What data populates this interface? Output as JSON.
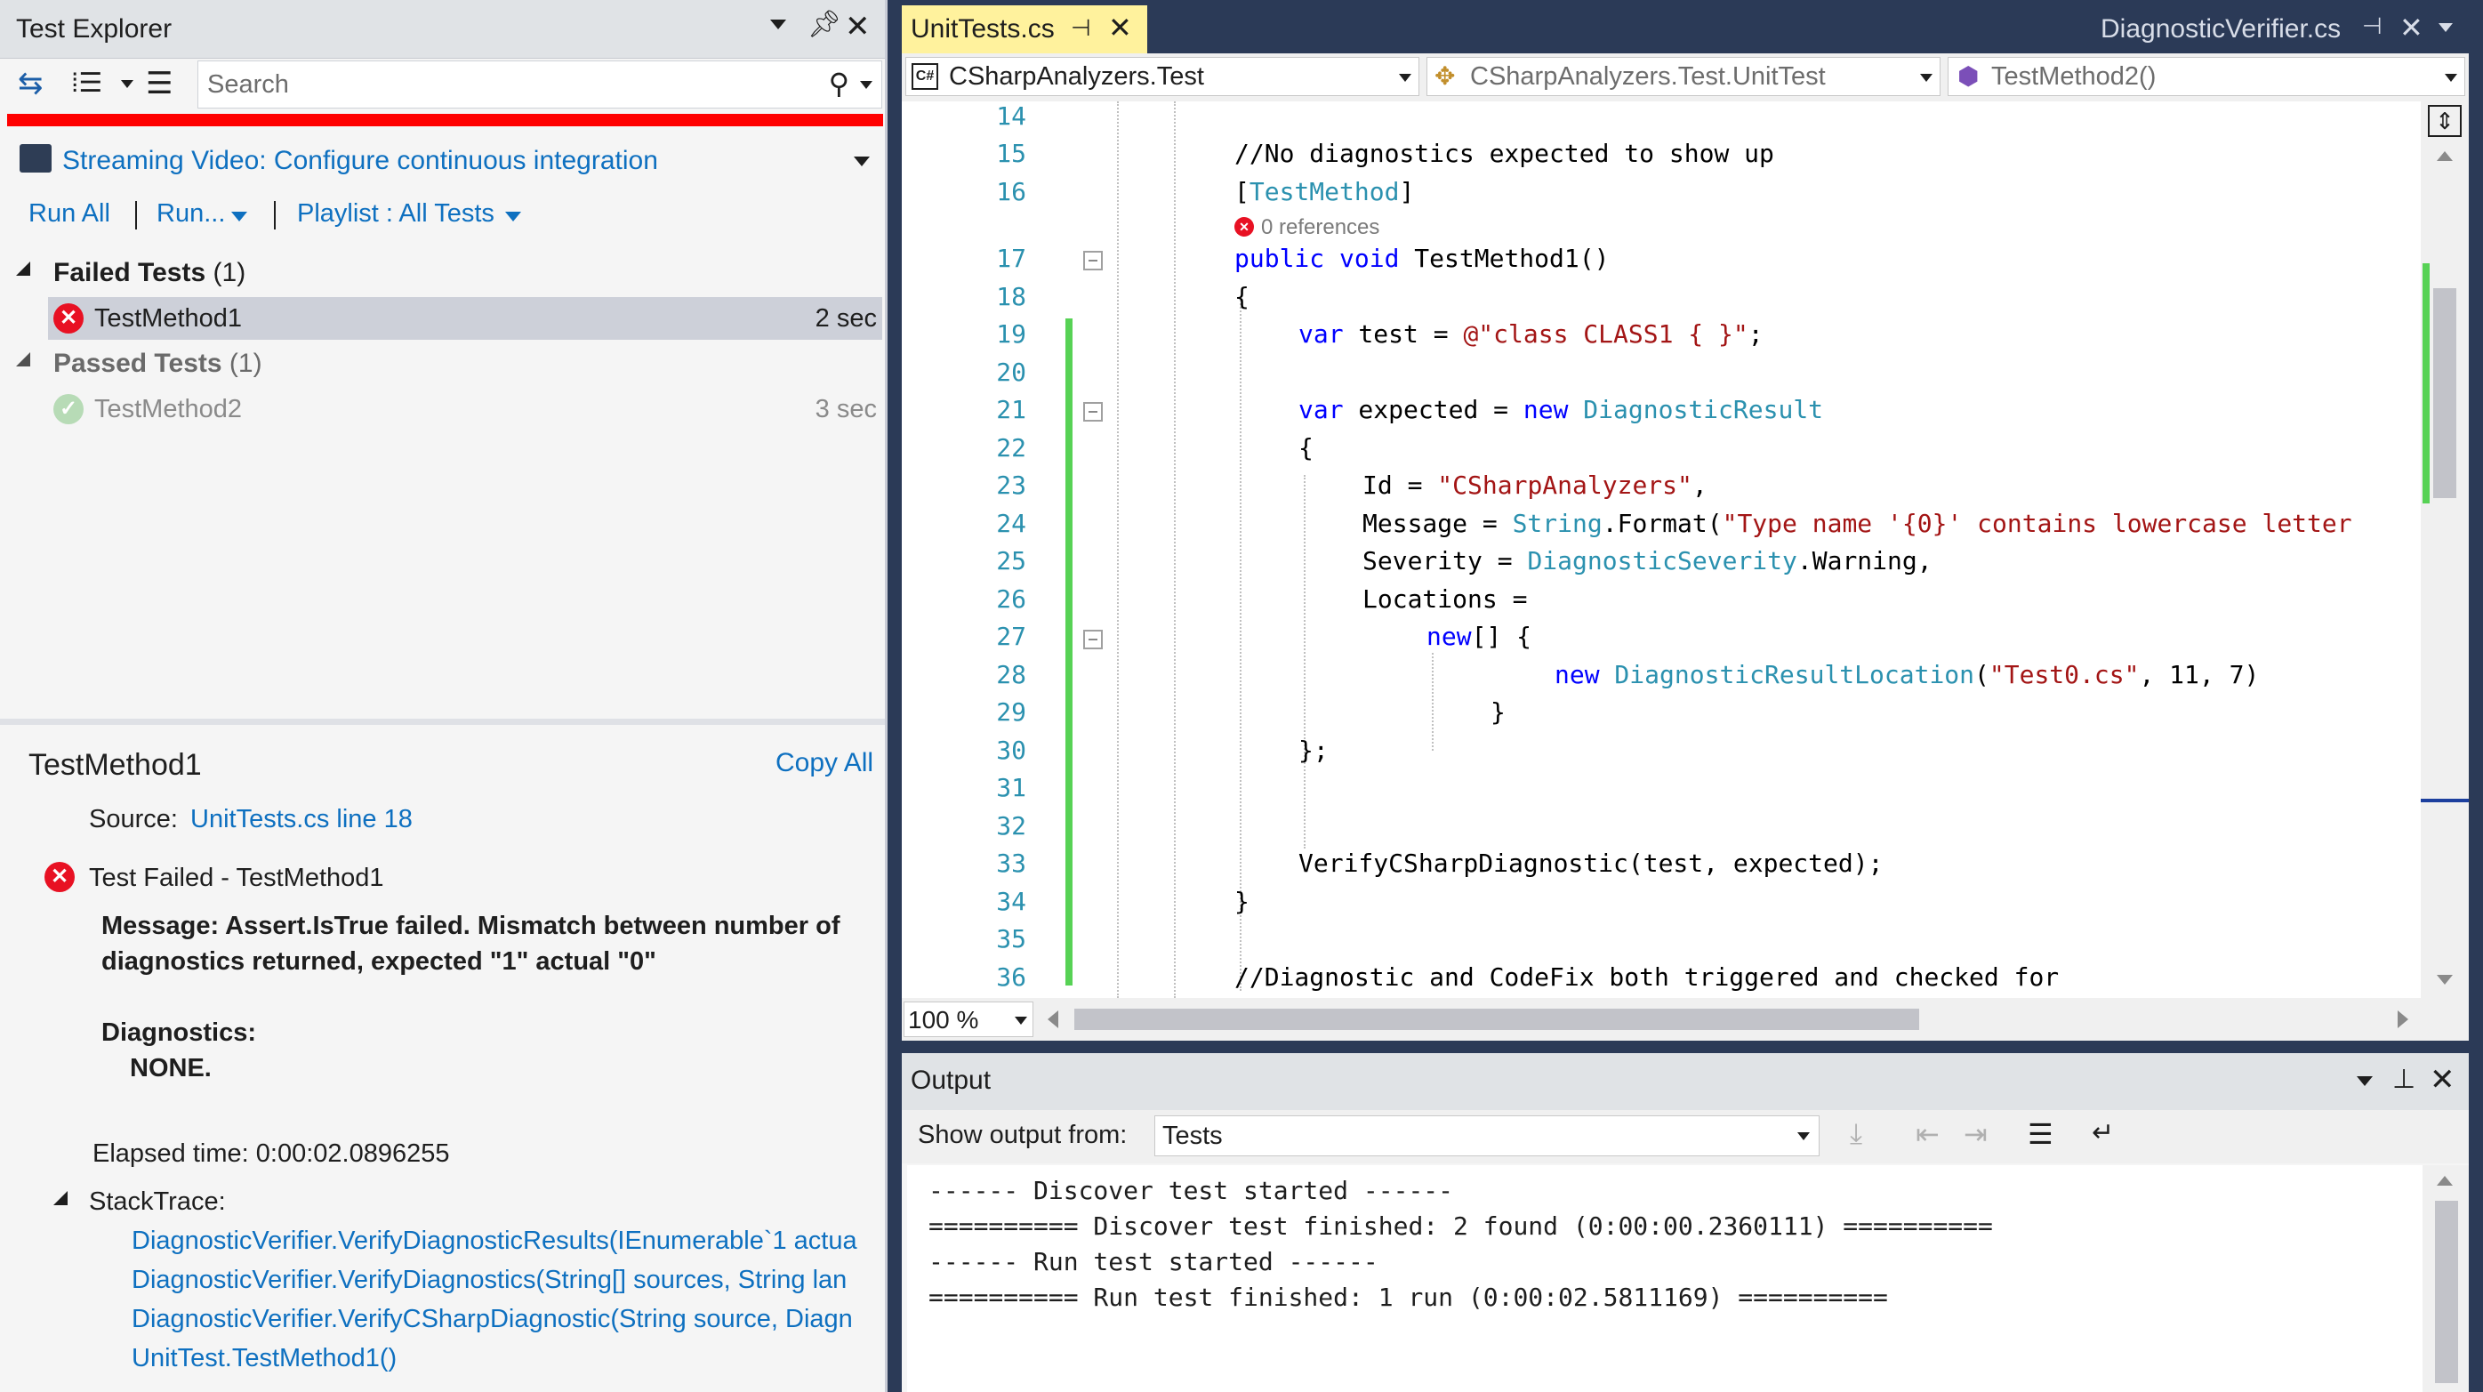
{
  "test_explorer": {
    "title": "Test Explorer",
    "search_placeholder": "Search",
    "streaming_label": "Streaming Video: Configure continuous integration",
    "run_all": "Run All",
    "run": "Run...",
    "playlist": "Playlist : All Tests",
    "failed_group": {
      "title": "Failed Tests",
      "count": "(1)"
    },
    "failed_tests": [
      {
        "name": "TestMethod1",
        "duration": "2 sec"
      }
    ],
    "passed_group": {
      "title": "Passed Tests",
      "count": "(1)"
    },
    "passed_tests": [
      {
        "name": "TestMethod2",
        "duration": "3 sec"
      }
    ],
    "progress_color": "#ff0000"
  },
  "details": {
    "title": "TestMethod1",
    "copy_all": "Copy All",
    "source_label": "Source:",
    "source_link": "UnitTests.cs line 18",
    "status": "Test Failed - TestMethod1",
    "message_line1": "Message: Assert.IsTrue failed. Mismatch between number of",
    "message_line2": "diagnostics returned, expected \"1\" actual \"0\"",
    "diagnostics_label": "Diagnostics:",
    "diagnostics_value": "NONE.",
    "elapsed": "Elapsed time: 0:00:02.0896255",
    "stacktrace_label": "StackTrace:",
    "stacktrace": [
      "DiagnosticVerifier.VerifyDiagnosticResults(IEnumerable`1 actua",
      "DiagnosticVerifier.VerifyDiagnostics(String[] sources, String lan",
      "DiagnosticVerifier.VerifyCSharpDiagnostic(String source, Diagn",
      "UnitTest.TestMethod1()"
    ]
  },
  "editor": {
    "active_tab": "UnitTests.cs",
    "other_tab": "DiagnosticVerifier.cs",
    "nav": {
      "project": "CSharpAnalyzers.Test",
      "class": "CSharpAnalyzers.Test.UnitTest",
      "member": "TestMethod2()"
    },
    "references": "0 references",
    "zoom": "100 %",
    "lines": {
      "n14": "14",
      "n15": "15",
      "n16": "16",
      "n17": "17",
      "n18": "18",
      "n19": "19",
      "n20": "20",
      "n21": "21",
      "n22": "22",
      "n23": "23",
      "n24": "24",
      "n25": "25",
      "n26": "26",
      "n27": "27",
      "n28": "28",
      "n29": "29",
      "n30": "30",
      "n31": "31",
      "n32": "32",
      "n33": "33",
      "n34": "34",
      "n35": "35",
      "n36": "36"
    },
    "code": {
      "c15": "//No diagnostics expected to show up",
      "c16_open": "[",
      "c16_attr": "TestMethod",
      "c16_close": "]",
      "c17_kw": "public void",
      "c17_rest": " TestMethod1()",
      "c18": "{",
      "c19_kw": "var",
      "c19_mid": " test = ",
      "c19_str": "@\"class CLASS1 { }\"",
      "c19_end": ";",
      "c21_kw": "var",
      "c21_mid": " expected = ",
      "c21_new": "new",
      "c21_type": " DiagnosticResult",
      "c22": "{",
      "c23_mid": "Id = ",
      "c23_str": "\"CSharpAnalyzers\"",
      "c23_end": ",",
      "c24_mid": "Message = ",
      "c24_type": "String",
      "c24_fmt": ".Format(",
      "c24_str": "\"Type name '{0}' contains lowercase letter",
      "c25_mid": "Severity = ",
      "c25_type": "DiagnosticSeverity",
      "c25_end": ".Warning,",
      "c26": "Locations =",
      "c27_kw": "new",
      "c27_end": "[] {",
      "c28_kw": "new",
      "c28_type": " DiagnosticResultLocation",
      "c28_open": "(",
      "c28_str": "\"Test0.cs\"",
      "c28_end": ", 11, 7)",
      "c29": "}",
      "c30": "};",
      "c33": "VerifyCSharpDiagnostic(test, expected);",
      "c34": "}",
      "c36": "//Diagnostic and CodeFix both triggered and checked for"
    }
  },
  "output": {
    "title": "Output",
    "show_from_label": "Show output from:",
    "source": "Tests",
    "lines": [
      "------ Discover test started ------",
      "========== Discover test finished: 2 found (0:00:00.2360111) ==========",
      "------ Run test started ------",
      "========== Run test finished: 1 run (0:00:02.5811169) =========="
    ]
  }
}
